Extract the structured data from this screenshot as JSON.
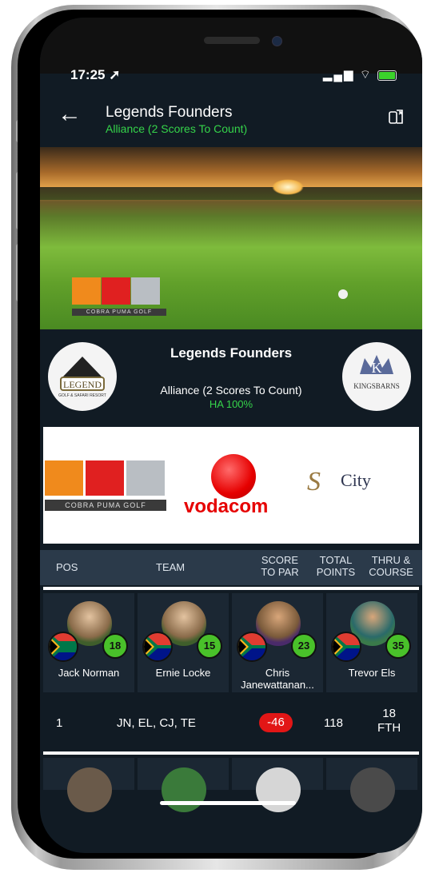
{
  "status_bar": {
    "time": "17:25 ➚",
    "icons": "▂▄▆ ⌔"
  },
  "header": {
    "title": "Legends Founders",
    "subtitle": "Alliance (2 Scores To Count)"
  },
  "banner": {
    "sponsor_caption": "COBRA PUMA GOLF"
  },
  "event": {
    "title": "Legends Founders",
    "format": "Alliance (2 Scores To Count)",
    "handicap": "HA 100%",
    "left_logo_text": "LEGEND",
    "left_logo_sub": "GOLF & SAFARI RESORT",
    "right_logo_text": "KINGSBARNS"
  },
  "sponsors": {
    "cobra_caption": "COBRA PUMA GOLF",
    "vodacom": "vodacom",
    "suncity": "City"
  },
  "table_header": {
    "pos": "POS",
    "team": "TEAM",
    "score_l1": "SCORE",
    "score_l2": "TO PAR",
    "points_l1": "TOTAL",
    "points_l2": "POINTS",
    "thru_l1": "THRU &",
    "thru_l2": "COURSE"
  },
  "players": [
    {
      "name": "Jack Norman",
      "handicap": "18"
    },
    {
      "name": "Ernie Locke",
      "handicap": "15"
    },
    {
      "name": "Chris Janewattanan...",
      "handicap": "23"
    },
    {
      "name": "Trevor Els",
      "handicap": "35"
    }
  ],
  "result_row": {
    "pos": "1",
    "team": "JN, EL, CJ, TE",
    "score": "-46",
    "points": "118",
    "thru_l1": "18",
    "thru_l2": "FTH"
  },
  "colors": {
    "accent_green": "#35d44a",
    "score_red": "#e21616",
    "bg_dark": "#111b24"
  }
}
